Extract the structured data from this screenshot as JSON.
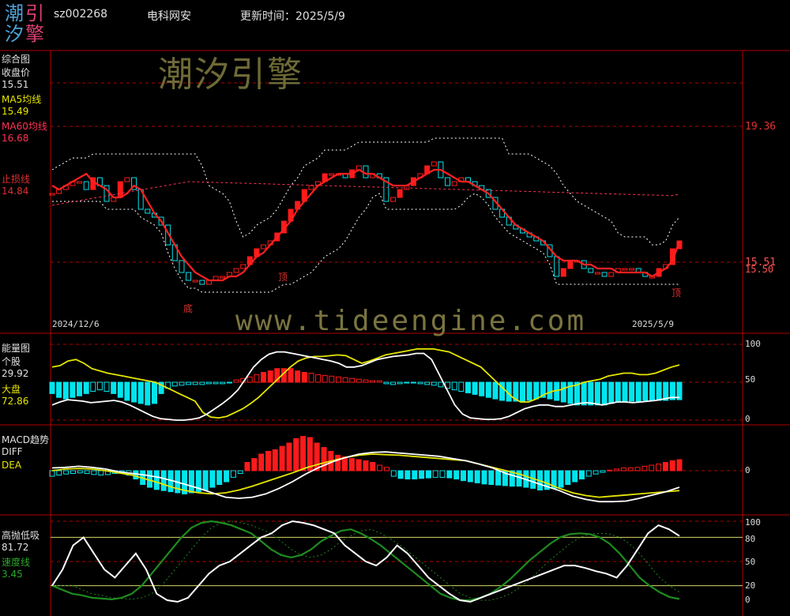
{
  "header": {
    "logo_chars": [
      "潮",
      "引",
      "汐",
      "擎"
    ],
    "code": "sz002268",
    "name": "电科网安",
    "update_label": "更新时间：2025/5/9"
  },
  "watermark": {
    "cn": "潮汐引擎",
    "url": "www.tideengine.com"
  },
  "colors": {
    "up": "#ff1a1a",
    "down": "#00e5ee",
    "ma5": "#e6e600",
    "ma60": "#ff3355",
    "grid": "#b00000",
    "green": "#1e8c1e"
  },
  "panel1": {
    "title": "综合图",
    "close_label": "收盘价",
    "close_value": "15.51",
    "ma5_label": "MA5均线",
    "ma5_value": "15.49",
    "ma60_label": "MA60均线",
    "ma60_value": "16.68",
    "stop_label": "止损线",
    "stop_value": "14.84",
    "axis_top": "19.36",
    "axis_price": "15.51",
    "axis_under": "15.50",
    "mark_bottom": "底",
    "mark_top": "顶",
    "mark_end": "顶",
    "date_start": "2024/12/6",
    "date_end": "2025/5/9"
  },
  "panel2": {
    "title": "能量图",
    "stock_label": "个股",
    "stock_value": "29.92",
    "market_label": "大盘",
    "market_value": "72.86",
    "ticks": [
      "100",
      "50",
      "0"
    ]
  },
  "panel3": {
    "title": "MACD趋势",
    "diff_label": "DIFF",
    "dea_label": "DEA",
    "ticks": [
      "0"
    ]
  },
  "panel4": {
    "title": "高抛低吸",
    "value": "81.72",
    "speed_label": "速度线",
    "speed_value": "3.45",
    "ticks": [
      "100",
      "80",
      "50",
      "20",
      "0"
    ]
  },
  "chart_data": [
    {
      "type": "candlestick",
      "title": "综合图",
      "x": [
        "2024/12/6",
        "2025/5/9"
      ],
      "ylim": [
        14.0,
        20.0
      ],
      "close": [
        16.7,
        16.8,
        16.9,
        17.0,
        17.0,
        16.8,
        17.1,
        16.9,
        16.5,
        16.6,
        17.0,
        17.1,
        16.8,
        16.3,
        16.2,
        16.1,
        15.9,
        15.4,
        15.0,
        14.7,
        14.5,
        14.5,
        14.4,
        14.5,
        14.6,
        14.6,
        14.7,
        14.8,
        14.9,
        15.1,
        15.3,
        15.4,
        15.5,
        15.7,
        16.0,
        16.3,
        16.5,
        16.8,
        16.9,
        17.0,
        17.2,
        17.2,
        17.2,
        17.1,
        17.3,
        17.4,
        17.1,
        17.2,
        17.1,
        16.5,
        16.6,
        16.8,
        16.9,
        17.1,
        17.2,
        17.4,
        17.5,
        17.1,
        16.9,
        17.0,
        17.1,
        17.0,
        16.9,
        16.8,
        16.6,
        16.3,
        16.1,
        15.9,
        15.8,
        15.7,
        15.6,
        15.5,
        15.4,
        15.1,
        14.6,
        14.8,
        15.0,
        15.0,
        14.8,
        14.7,
        14.7,
        14.6,
        14.7,
        14.8,
        14.8,
        14.8,
        14.7,
        14.6,
        14.6,
        14.8,
        14.9,
        15.3,
        15.5
      ],
      "ma5": [
        16.9,
        16.8,
        16.9,
        17.0,
        17.1,
        17.2,
        17.0,
        16.9,
        16.8,
        16.6,
        16.6,
        16.7,
        16.9,
        16.8,
        16.5,
        16.2,
        16.0,
        15.7,
        15.4,
        15.1,
        14.9,
        14.7,
        14.6,
        14.5,
        14.5,
        14.5,
        14.6,
        14.6,
        14.7,
        14.9,
        15.1,
        15.2,
        15.4,
        15.6,
        15.8,
        16.0,
        16.3,
        16.5,
        16.7,
        16.9,
        17.0,
        17.1,
        17.2,
        17.2,
        17.2,
        17.3,
        17.2,
        17.2,
        17.1,
        17.0,
        16.9,
        16.9,
        16.9,
        17.0,
        17.1,
        17.2,
        17.3,
        17.3,
        17.2,
        17.1,
        17.0,
        17.0,
        16.9,
        16.8,
        16.7,
        16.5,
        16.3,
        16.1,
        15.9,
        15.8,
        15.7,
        15.6,
        15.5,
        15.3,
        15.1,
        15.0,
        15.0,
        15.0,
        14.9,
        14.9,
        14.8,
        14.8,
        14.8,
        14.7,
        14.7,
        14.7,
        14.7,
        14.7,
        14.6,
        14.7,
        14.8,
        15.0,
        15.49
      ],
      "ma60_end": 16.68,
      "stop": 14.84
    },
    {
      "type": "bar+line",
      "title": "能量图",
      "ylim": [
        0,
        100
      ],
      "bars": [
        -15,
        -20,
        -22,
        -20,
        -18,
        -15,
        -12,
        -10,
        -12,
        -15,
        -20,
        -24,
        -26,
        -28,
        -30,
        -28,
        -15,
        -8,
        -5,
        -4,
        -3,
        -3,
        -3,
        -2,
        -2,
        -2,
        -1,
        3,
        5,
        7,
        10,
        13,
        15,
        18,
        18,
        18,
        15,
        13,
        12,
        10,
        9,
        8,
        7,
        6,
        5,
        4,
        3,
        2,
        2,
        -2,
        -3,
        -2,
        -1,
        -1,
        -2,
        -3,
        -4,
        -6,
        -8,
        -10,
        -12,
        -14,
        -16,
        -18,
        -20,
        -22,
        -24,
        -25,
        -25,
        -25,
        -24,
        -22,
        -20,
        -22,
        -24,
        -26,
        -28,
        -30,
        -30,
        -30,
        -30,
        -30,
        -28,
        -26,
        -26,
        -25,
        -25,
        -24,
        -24,
        -24,
        -24,
        -23,
        -23
      ],
      "stock": [
        20,
        24,
        27,
        26,
        25,
        23,
        24,
        25,
        26,
        24,
        20,
        15,
        10,
        5,
        2,
        1,
        0,
        0,
        1,
        3,
        8,
        15,
        22,
        30,
        40,
        55,
        70,
        80,
        87,
        90,
        90,
        88,
        86,
        84,
        82,
        80,
        78,
        75,
        70,
        70,
        72,
        76,
        80,
        82,
        84,
        85,
        86,
        88,
        88,
        80,
        60,
        40,
        20,
        8,
        3,
        2,
        1,
        1,
        2,
        5,
        10,
        15,
        18,
        20,
        20,
        18,
        18,
        20,
        22,
        23,
        22,
        20,
        22,
        24,
        24,
        23,
        24,
        25,
        26,
        28,
        30,
        29.92
      ],
      "market": [
        70,
        72,
        78,
        80,
        75,
        68,
        65,
        62,
        60,
        58,
        56,
        54,
        52,
        50,
        45,
        40,
        35,
        30,
        25,
        10,
        4,
        3,
        5,
        10,
        15,
        22,
        30,
        40,
        50,
        60,
        70,
        78,
        82,
        84,
        84,
        85,
        86,
        85,
        80,
        75,
        78,
        82,
        86,
        88,
        90,
        92,
        94,
        94,
        94,
        92,
        90,
        85,
        80,
        75,
        70,
        60,
        50,
        40,
        30,
        24,
        24,
        28,
        34,
        38,
        40,
        44,
        46,
        50,
        52,
        54,
        58,
        60,
        62,
        62,
        60,
        60,
        62,
        66,
        70,
        72.86
      ]
    },
    {
      "type": "bar+line",
      "title": "MACD趋势",
      "bars": [
        -0.1,
        -0.08,
        -0.06,
        -0.05,
        -0.04,
        -0.05,
        -0.07,
        -0.08,
        -0.07,
        -0.05,
        -0.02,
        -0.08,
        -0.15,
        -0.25,
        -0.3,
        -0.34,
        -0.36,
        -0.38,
        -0.4,
        -0.42,
        -0.4,
        -0.38,
        -0.35,
        -0.3,
        -0.25,
        -0.2,
        -0.12,
        -0.05,
        0.15,
        0.22,
        0.3,
        0.35,
        0.38,
        0.44,
        0.5,
        0.58,
        0.62,
        0.6,
        0.5,
        0.42,
        0.35,
        0.28,
        0.25,
        0.22,
        0.2,
        0.18,
        0.15,
        0.1,
        0.06,
        -0.1,
        -0.14,
        -0.15,
        -0.15,
        -0.14,
        -0.13,
        -0.12,
        -0.12,
        -0.13,
        -0.15,
        -0.18,
        -0.2,
        -0.22,
        -0.24,
        -0.25,
        -0.26,
        -0.27,
        -0.28,
        -0.28,
        -0.3,
        -0.32,
        -0.35,
        -0.34,
        -0.32,
        -0.3,
        -0.25,
        -0.2,
        -0.15,
        -0.1,
        -0.06,
        -0.03,
        0.01,
        0.03,
        0.05,
        0.05,
        0.06,
        0.08,
        0.1,
        0.12,
        0.15,
        0.18,
        0.2
      ],
      "diff": [
        0.05,
        0.06,
        0.08,
        0.06,
        0.03,
        -0.02,
        -0.05,
        -0.08,
        -0.12,
        -0.18,
        -0.25,
        -0.32,
        -0.4,
        -0.48,
        -0.5,
        -0.48,
        -0.42,
        -0.32,
        -0.2,
        -0.06,
        0.06,
        0.16,
        0.24,
        0.3,
        0.33,
        0.34,
        0.32,
        0.3,
        0.28,
        0.26,
        0.22,
        0.18,
        0.12,
        0.05,
        -0.05,
        -0.12,
        -0.2,
        -0.28,
        -0.36,
        -0.46,
        -0.52,
        -0.56,
        -0.56,
        -0.55,
        -0.5,
        -0.44,
        -0.38,
        -0.3
      ],
      "dea": [
        0.0,
        0.03,
        0.04,
        0.03,
        0.0,
        -0.04,
        -0.08,
        -0.15,
        -0.22,
        -0.3,
        -0.36,
        -0.4,
        -0.42,
        -0.4,
        -0.35,
        -0.28,
        -0.2,
        -0.12,
        -0.04,
        0.05,
        0.12,
        0.18,
        0.24,
        0.28,
        0.3,
        0.29,
        0.28,
        0.26,
        0.24,
        0.22,
        0.2,
        0.18,
        0.12,
        0.06,
        0.0,
        -0.06,
        -0.14,
        -0.22,
        -0.32,
        -0.4,
        -0.45,
        -0.48,
        -0.46,
        -0.44,
        -0.42,
        -0.4,
        -0.38,
        -0.36
      ]
    },
    {
      "type": "line",
      "title": "高抛低吸",
      "ylim": [
        0,
        100
      ],
      "levels": [
        100,
        80,
        50,
        20,
        0
      ],
      "main": [
        20,
        40,
        70,
        80,
        60,
        40,
        30,
        45,
        60,
        40,
        10,
        2,
        0,
        5,
        20,
        35,
        45,
        50,
        60,
        70,
        80,
        85,
        95,
        100,
        98,
        95,
        90,
        85,
        70,
        60,
        50,
        45,
        55,
        70,
        60,
        45,
        30,
        20,
        10,
        2,
        0,
        5,
        10,
        15,
        20,
        25,
        30,
        35,
        40,
        45,
        45,
        42,
        38,
        35,
        30,
        45,
        65,
        85,
        95,
        90,
        81.72
      ],
      "speed": [
        20,
        15,
        10,
        8,
        5,
        4,
        3,
        5,
        10,
        20,
        35,
        50,
        65,
        80,
        92,
        98,
        100,
        98,
        95,
        90,
        85,
        75,
        65,
        58,
        55,
        58,
        65,
        75,
        82,
        88,
        90,
        85,
        78,
        70,
        60,
        50,
        40,
        30,
        20,
        10,
        5,
        2,
        2,
        5,
        10,
        18,
        28,
        40,
        52,
        62,
        72,
        80,
        84,
        85,
        84,
        80,
        72,
        60,
        45,
        30,
        20,
        12,
        6,
        3.45
      ]
    }
  ]
}
